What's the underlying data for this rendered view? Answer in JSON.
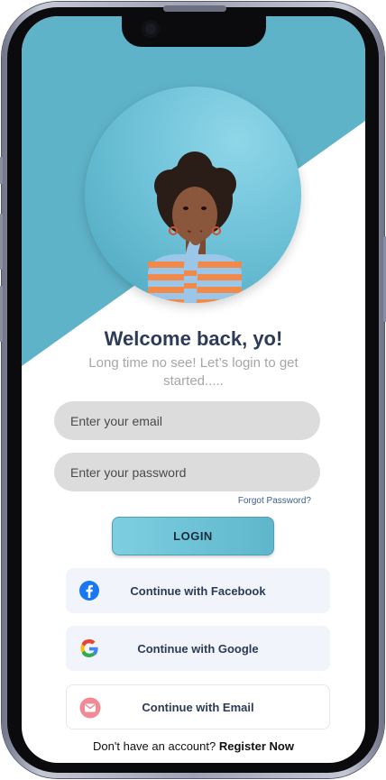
{
  "welcome": {
    "title": "Welcome back, yo!",
    "subtitle": "Long time no see! Let’s login to get started....."
  },
  "form": {
    "email_placeholder": "Enter your email",
    "password_placeholder": "Enter your password",
    "forgot_label": "Forgot Password?",
    "login_label": "LOGIN"
  },
  "social": {
    "facebook_label": "Continue with Facebook",
    "google_label": "Continue with Google",
    "email_label": "Continue with Email"
  },
  "footer": {
    "prompt": "Don't have an account?",
    "register_label": "Register Now"
  },
  "colors": {
    "accent": "#5fb6cb",
    "background_shape": "#5fb3c9",
    "title": "#2d3b5a",
    "facebook": "#1877f2",
    "email_icon": "#f08a95"
  },
  "icons": {
    "facebook": "facebook-icon",
    "google": "google-icon",
    "email": "mail-icon"
  }
}
